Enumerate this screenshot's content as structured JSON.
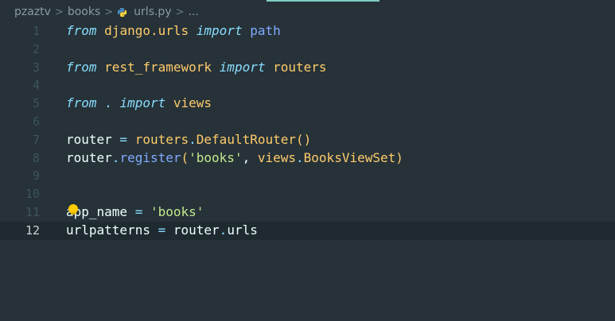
{
  "breadcrumb": {
    "items": [
      "pzaztv",
      "books",
      "urls.py",
      "..."
    ],
    "separator": ">",
    "file_icon": "python-icon"
  },
  "colors": {
    "background": "#263238",
    "keyword": "#89ddff",
    "module": "#ffcb6b",
    "function": "#82aaff",
    "string": "#c3e88d",
    "plain": "#eeffff"
  },
  "editor": {
    "current_line": 12,
    "lines": [
      {
        "num": "1",
        "tokens": [
          {
            "t": "from",
            "c": "kw"
          },
          {
            "t": " ",
            "c": "pl"
          },
          {
            "t": "django.urls",
            "c": "mod"
          },
          {
            "t": " ",
            "c": "pl"
          },
          {
            "t": "import",
            "c": "kw"
          },
          {
            "t": " ",
            "c": "pl"
          },
          {
            "t": "path",
            "c": "fn"
          }
        ]
      },
      {
        "num": "2",
        "tokens": []
      },
      {
        "num": "3",
        "tokens": [
          {
            "t": "from",
            "c": "kw"
          },
          {
            "t": " ",
            "c": "pl"
          },
          {
            "t": "rest_framework",
            "c": "mod"
          },
          {
            "t": " ",
            "c": "pl"
          },
          {
            "t": "import",
            "c": "kw"
          },
          {
            "t": " ",
            "c": "pl"
          },
          {
            "t": "routers",
            "c": "mod"
          }
        ]
      },
      {
        "num": "4",
        "tokens": []
      },
      {
        "num": "5",
        "tokens": [
          {
            "t": "from",
            "c": "kw"
          },
          {
            "t": " ",
            "c": "pl"
          },
          {
            "t": ".",
            "c": "op"
          },
          {
            "t": " ",
            "c": "pl"
          },
          {
            "t": "import",
            "c": "kw"
          },
          {
            "t": " ",
            "c": "pl"
          },
          {
            "t": "views",
            "c": "mod"
          }
        ]
      },
      {
        "num": "6",
        "tokens": []
      },
      {
        "num": "7",
        "tokens": [
          {
            "t": "router",
            "c": "pl"
          },
          {
            "t": " = ",
            "c": "op"
          },
          {
            "t": "routers",
            "c": "mod"
          },
          {
            "t": ".",
            "c": "op"
          },
          {
            "t": "DefaultRouter",
            "c": "mod"
          },
          {
            "t": "()",
            "c": "mod"
          }
        ]
      },
      {
        "num": "8",
        "tokens": [
          {
            "t": "router",
            "c": "pl"
          },
          {
            "t": ".",
            "c": "op"
          },
          {
            "t": "register",
            "c": "fn"
          },
          {
            "t": "(",
            "c": "mod"
          },
          {
            "t": "'books'",
            "c": "str"
          },
          {
            "t": ", ",
            "c": "pl"
          },
          {
            "t": "views",
            "c": "mod"
          },
          {
            "t": ".",
            "c": "op"
          },
          {
            "t": "BooksViewSet",
            "c": "mod"
          },
          {
            "t": ")",
            "c": "mod"
          }
        ]
      },
      {
        "num": "9",
        "tokens": []
      },
      {
        "num": "10",
        "tokens": []
      },
      {
        "num": "11",
        "tokens": [
          {
            "t": "app_name",
            "c": "pl"
          },
          {
            "t": " = ",
            "c": "op"
          },
          {
            "t": "'books'",
            "c": "str"
          }
        ]
      },
      {
        "num": "12",
        "tokens": [
          {
            "t": "urlpatterns",
            "c": "pl"
          },
          {
            "t": " = ",
            "c": "op"
          },
          {
            "t": "router",
            "c": "pl"
          },
          {
            "t": ".",
            "c": "op"
          },
          {
            "t": "urls",
            "c": "pl"
          }
        ]
      }
    ]
  },
  "lightbulb_icon": "lightbulb-icon"
}
